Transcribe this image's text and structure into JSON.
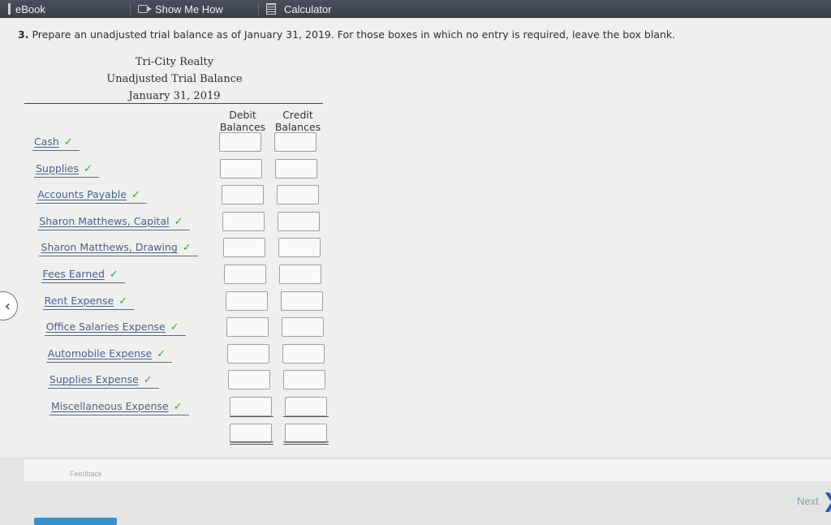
{
  "toolbar": {
    "ebook": "eBook",
    "show_me_how": "Show Me How",
    "calculator": "Calculator"
  },
  "question": {
    "number": "3.",
    "text": "Prepare an unadjusted trial balance as of January 31, 2019. For those boxes in which no entry is required, leave the box blank."
  },
  "statement": {
    "company": "Tri-City Realty",
    "title": "Unadjusted Trial Balance",
    "date": "January 31, 2019"
  },
  "columns": {
    "debit": [
      "Debit",
      "Balances"
    ],
    "credit": [
      "Credit",
      "Balances"
    ]
  },
  "accounts": [
    "Cash",
    "Supplies",
    "Accounts Payable",
    "Sharon Matthews, Capital",
    "Sharon Matthews, Drawing",
    "Fees Earned",
    "Rent Expense",
    "Office Salaries Expense",
    "Automobile Expense",
    "Supplies Expense",
    "Miscellaneous Expense"
  ],
  "check_mark": "✓",
  "footer": {
    "feedback": "Feedback",
    "next": "Next",
    "prev_arrow": "‹",
    "next_arrow": "❯"
  },
  "colors": {
    "toolbar_bg": "#3f4451",
    "account_link": "#4a5f8c",
    "check": "#3aa13a",
    "next_arrow": "#2b57b8"
  }
}
